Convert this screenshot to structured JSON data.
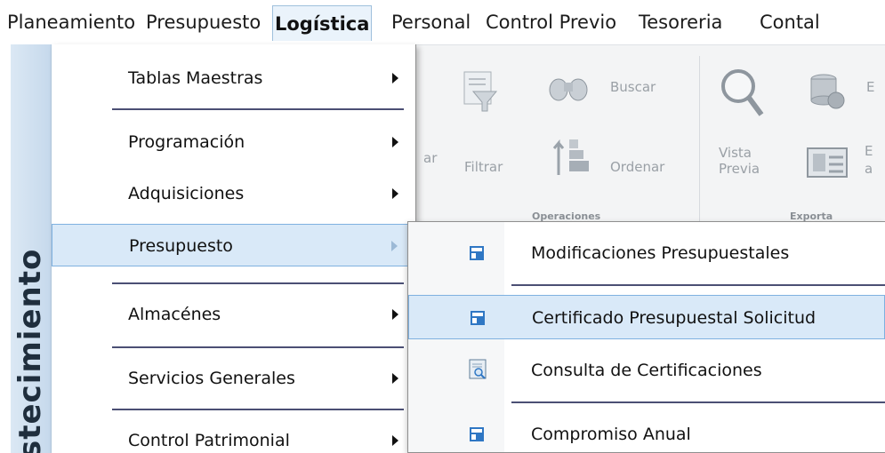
{
  "menubar": {
    "items": [
      {
        "label": "Planeamiento"
      },
      {
        "label": "Presupuesto"
      },
      {
        "label": "Logística"
      },
      {
        "label": "Personal"
      },
      {
        "label": "Control Previo"
      },
      {
        "label": "Tesoreria"
      },
      {
        "label": "Contal"
      }
    ],
    "active": "Logística"
  },
  "side_band": {
    "text": "stecimiento"
  },
  "ribbon": {
    "buttons": {
      "filtrar": "Filtrar",
      "buscar": "Buscar",
      "ordenar": "Ordenar",
      "vista_previa": "Vista\nPrevia",
      "exp1": "E",
      "exp2": "E",
      "exp2b": "a",
      "partial": "ar"
    },
    "groups": {
      "operaciones": "Operaciones",
      "exporta": "Exporta"
    }
  },
  "menu": {
    "items": [
      {
        "label": "Tablas Maestras",
        "has_submenu": true
      },
      {
        "label": "Programación",
        "has_submenu": true
      },
      {
        "label": "Adquisiciones",
        "has_submenu": true
      },
      {
        "label": "Presupuesto",
        "has_submenu": true,
        "highlighted": true
      },
      {
        "label": "Almacénes",
        "has_submenu": true
      },
      {
        "label": "Servicios Generales",
        "has_submenu": true
      },
      {
        "label": "Control Patrimonial",
        "has_submenu": true
      }
    ]
  },
  "submenu": {
    "items": [
      {
        "label": "Modificaciones Presupuestales",
        "icon": "blue-window-icon"
      },
      {
        "label": "Certificado Presupuestal Solicitud",
        "icon": "blue-window-icon",
        "highlighted": true
      },
      {
        "label": "Consulta de Certificaciones",
        "icon": "document-search-icon"
      },
      {
        "label": "Compromiso Anual",
        "icon": "blue-window-icon"
      }
    ]
  },
  "colors": {
    "highlight_bg": "#d9e9f8",
    "highlight_border": "#7fb1e0",
    "separator": "#4b4f74",
    "side_band": "#c6d9ec",
    "ribbon_bg": "#f3f4f5"
  }
}
